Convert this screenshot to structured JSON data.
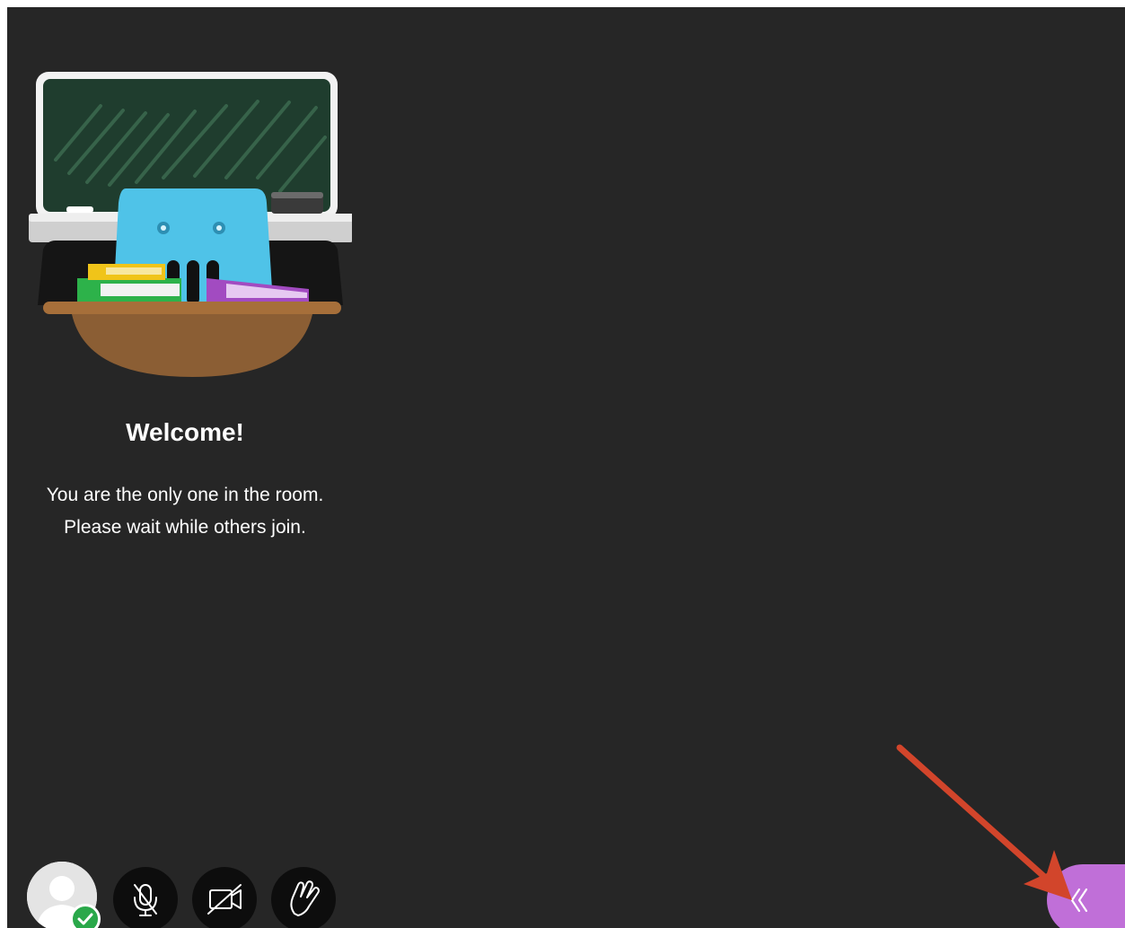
{
  "room": {
    "welcome_title": "Welcome!",
    "message_line1": "You are the only one in the room.",
    "message_line2": "Please wait while others join."
  },
  "controls": {
    "avatar_status": "connected",
    "buttons": [
      {
        "name": "microphone-off",
        "icon": "mic-off-icon"
      },
      {
        "name": "camera-off",
        "icon": "camera-off-icon"
      },
      {
        "name": "raise-hand",
        "icon": "hand-icon"
      }
    ]
  },
  "panel_toggle": {
    "icon": "double-chevron-left-icon"
  },
  "colors": {
    "stage_background": "#262626",
    "accent_purple": "#c06fd8",
    "status_green": "#2aa84a",
    "annotation_arrow": "#d2452b",
    "chalkboard": "#1f3d2e",
    "desk": "#8b5e34",
    "mascot_blue": "#4fc3e8"
  }
}
